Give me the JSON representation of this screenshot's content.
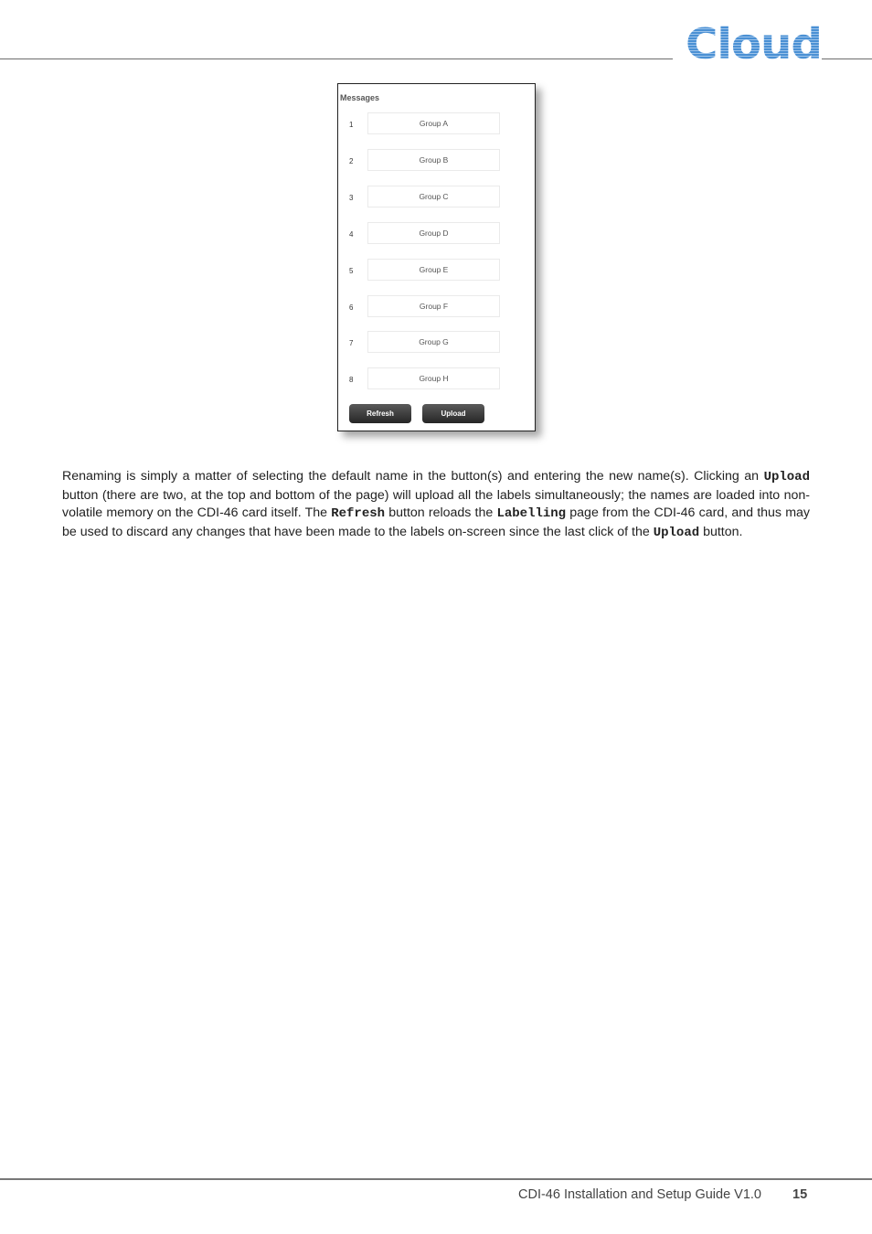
{
  "header": {
    "logo_text": "Cloud"
  },
  "screenshot": {
    "title": "Messages",
    "rows": [
      {
        "num": "1",
        "label": "Group A"
      },
      {
        "num": "2",
        "label": "Group B"
      },
      {
        "num": "3",
        "label": "Group C"
      },
      {
        "num": "4",
        "label": "Group D"
      },
      {
        "num": "5",
        "label": "Group E"
      },
      {
        "num": "6",
        "label": "Group F"
      },
      {
        "num": "7",
        "label": "Group G"
      },
      {
        "num": "8",
        "label": "Group H"
      }
    ],
    "refresh_label": "Refresh",
    "upload_label": "Upload"
  },
  "body": {
    "p1": "Renaming is simply a matter of selecting the default name in the button(s) and entering the new name(s). Clicking an ",
    "c1": "Upload",
    "p2": " button (there are two, at the top and bottom of the page) will upload all the labels simultaneously; the names are loaded into non-volatile memory on the CDI-46 card itself. The ",
    "c2": "Refresh",
    "p3": " button reloads the ",
    "c3": "Labelling",
    "p4": " page from the CDI-46 card, and thus may be used to discard any changes that have been made to the labels on-screen since the last click of the ",
    "c4": "Upload",
    "p5": " button."
  },
  "footer": {
    "title": "CDI-46 Installation and Setup Guide V1.0",
    "page": "15"
  }
}
